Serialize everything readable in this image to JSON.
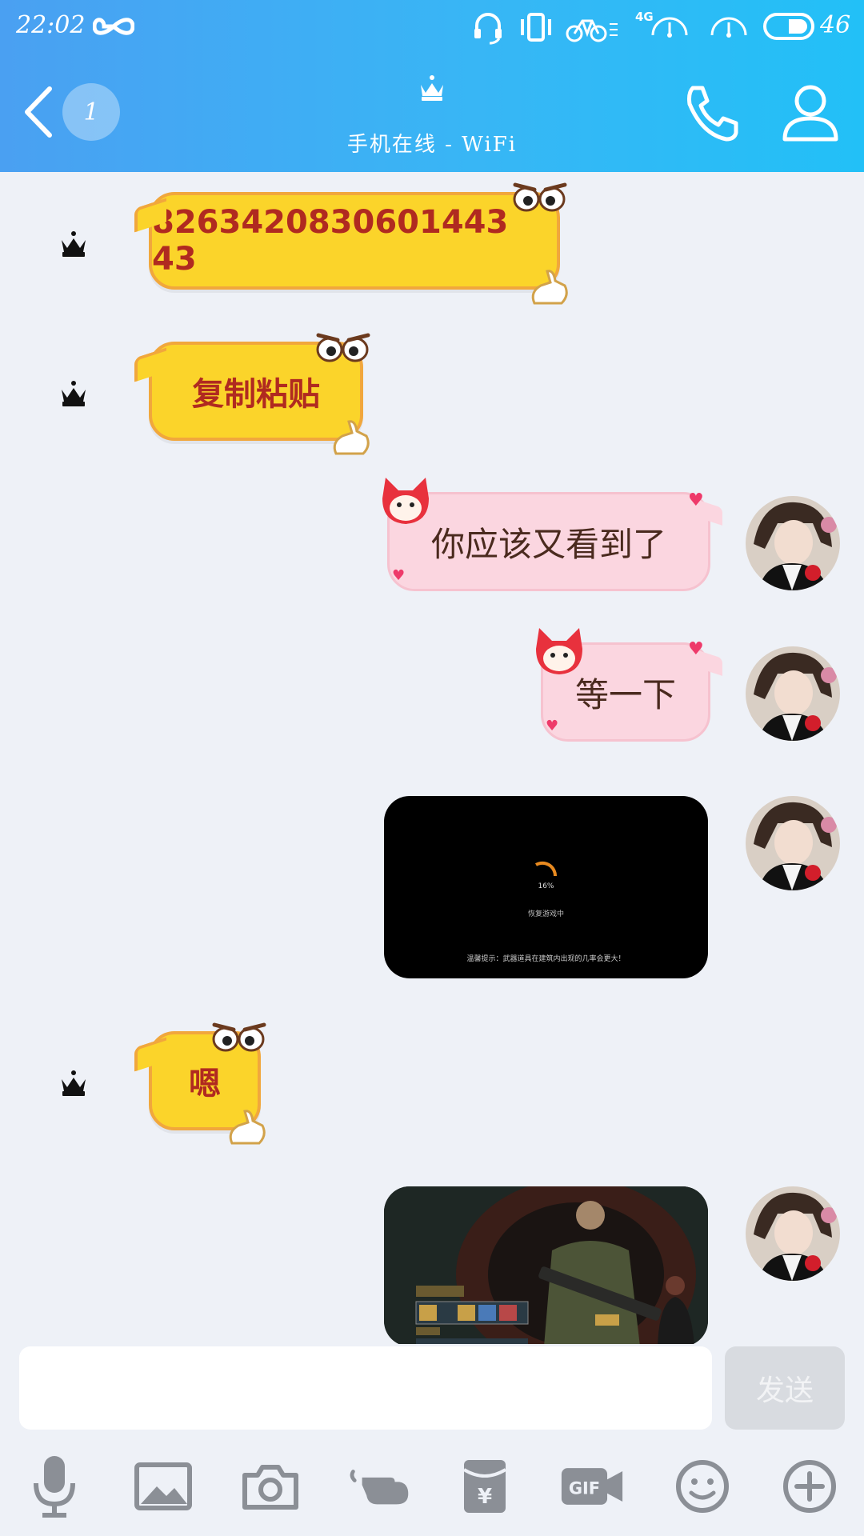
{
  "status_bar": {
    "time": "22:02",
    "network_label": "4G",
    "battery_level": "46"
  },
  "header": {
    "unread_count": "1",
    "subtitle": "手机在线 - WiFi"
  },
  "messages": [
    {
      "side": "left",
      "type": "text",
      "text": "8263420830601443 43"
    },
    {
      "side": "left",
      "type": "text",
      "text": "复制粘贴"
    },
    {
      "side": "right",
      "type": "text",
      "text": "你应该又看到了"
    },
    {
      "side": "right",
      "type": "text",
      "text": "等一下"
    },
    {
      "side": "right",
      "type": "image",
      "loading_percent": "16%",
      "loading_text": "恢复游戏中",
      "tip": "温馨提示：武器道具在建筑内出现的几率会更大！"
    },
    {
      "side": "left",
      "type": "text",
      "text": "嗯"
    },
    {
      "side": "right",
      "type": "image",
      "description": "game-screenshot"
    }
  ],
  "composer": {
    "input_value": "",
    "send_label": "发送"
  },
  "toolbar": {
    "icons": [
      "microphone-icon",
      "image-icon",
      "camera-icon",
      "poke-hand-icon",
      "red-packet-icon",
      "gif-icon",
      "emoji-icon",
      "plus-icon"
    ]
  },
  "colors": {
    "header_start": "#4aa0f2",
    "header_end": "#22c0f7",
    "chat_background": "#eef1f7",
    "yellow_bubble": "#fbd42a",
    "yellow_text": "#b02a20",
    "pink_bubble": "#fbd6e0"
  }
}
